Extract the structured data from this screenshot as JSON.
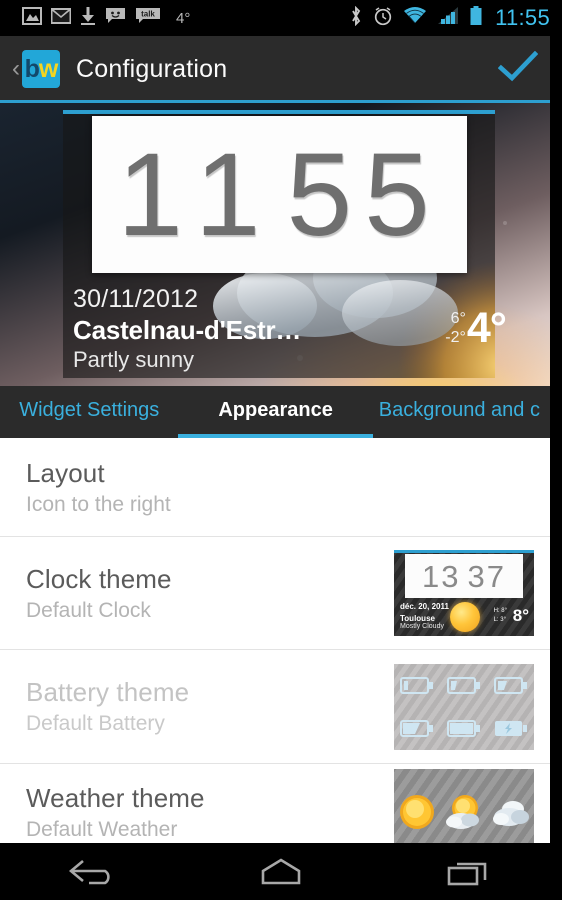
{
  "statusbar": {
    "icons_left": [
      "gallery-icon",
      "gmail-icon",
      "download-icon",
      "messaging-icon",
      "talk-icon"
    ],
    "talk_label": "talk",
    "temperature": "4°",
    "icons_right": [
      "bluetooth-icon",
      "alarm-icon",
      "wifi-icon",
      "signal-icon",
      "battery-icon"
    ],
    "clock": "11:55"
  },
  "actionbar": {
    "back_glyph": "‹",
    "app_icon_b": "b",
    "app_icon_w": "w",
    "title": "Configuration",
    "confirm_label": "check-icon",
    "accent_color": "#2d9fd0"
  },
  "preview": {
    "clock_h1": "1",
    "clock_h2": "1",
    "clock_m1": "5",
    "clock_m2": "5",
    "date": "30/11/2012",
    "location": "Castelnau-d'Estr…",
    "condition": "Partly sunny",
    "temp_high": "6°",
    "temp_low": "-2°",
    "temp_current": "4°"
  },
  "tabs": [
    {
      "label": "Widget Settings",
      "active": false
    },
    {
      "label": "Appearance",
      "active": true
    },
    {
      "label": "Background and c",
      "active": false
    }
  ],
  "list": [
    {
      "title": "Layout",
      "subtitle": "Icon to the right",
      "thumb": "none",
      "faded": false
    },
    {
      "title": "Clock theme",
      "subtitle": "Default Clock",
      "thumb": "clock",
      "faded": false
    },
    {
      "title": "Battery theme",
      "subtitle": "Default Battery",
      "thumb": "battery",
      "faded": true
    },
    {
      "title": "Weather theme",
      "subtitle": "Default Weather",
      "thumb": "weather",
      "faded": false
    }
  ],
  "clock_thumb": {
    "h": "13",
    "m": "37",
    "date": "déc. 20, 2011",
    "city": "Toulouse",
    "condition": "Mostly Cloudy",
    "high_label": "H:",
    "low_label": "L:",
    "high": "8°",
    "low": "3°",
    "current": "8°"
  },
  "navbar": {
    "back": "back-icon",
    "home": "home-icon",
    "recents": "recents-icon"
  }
}
